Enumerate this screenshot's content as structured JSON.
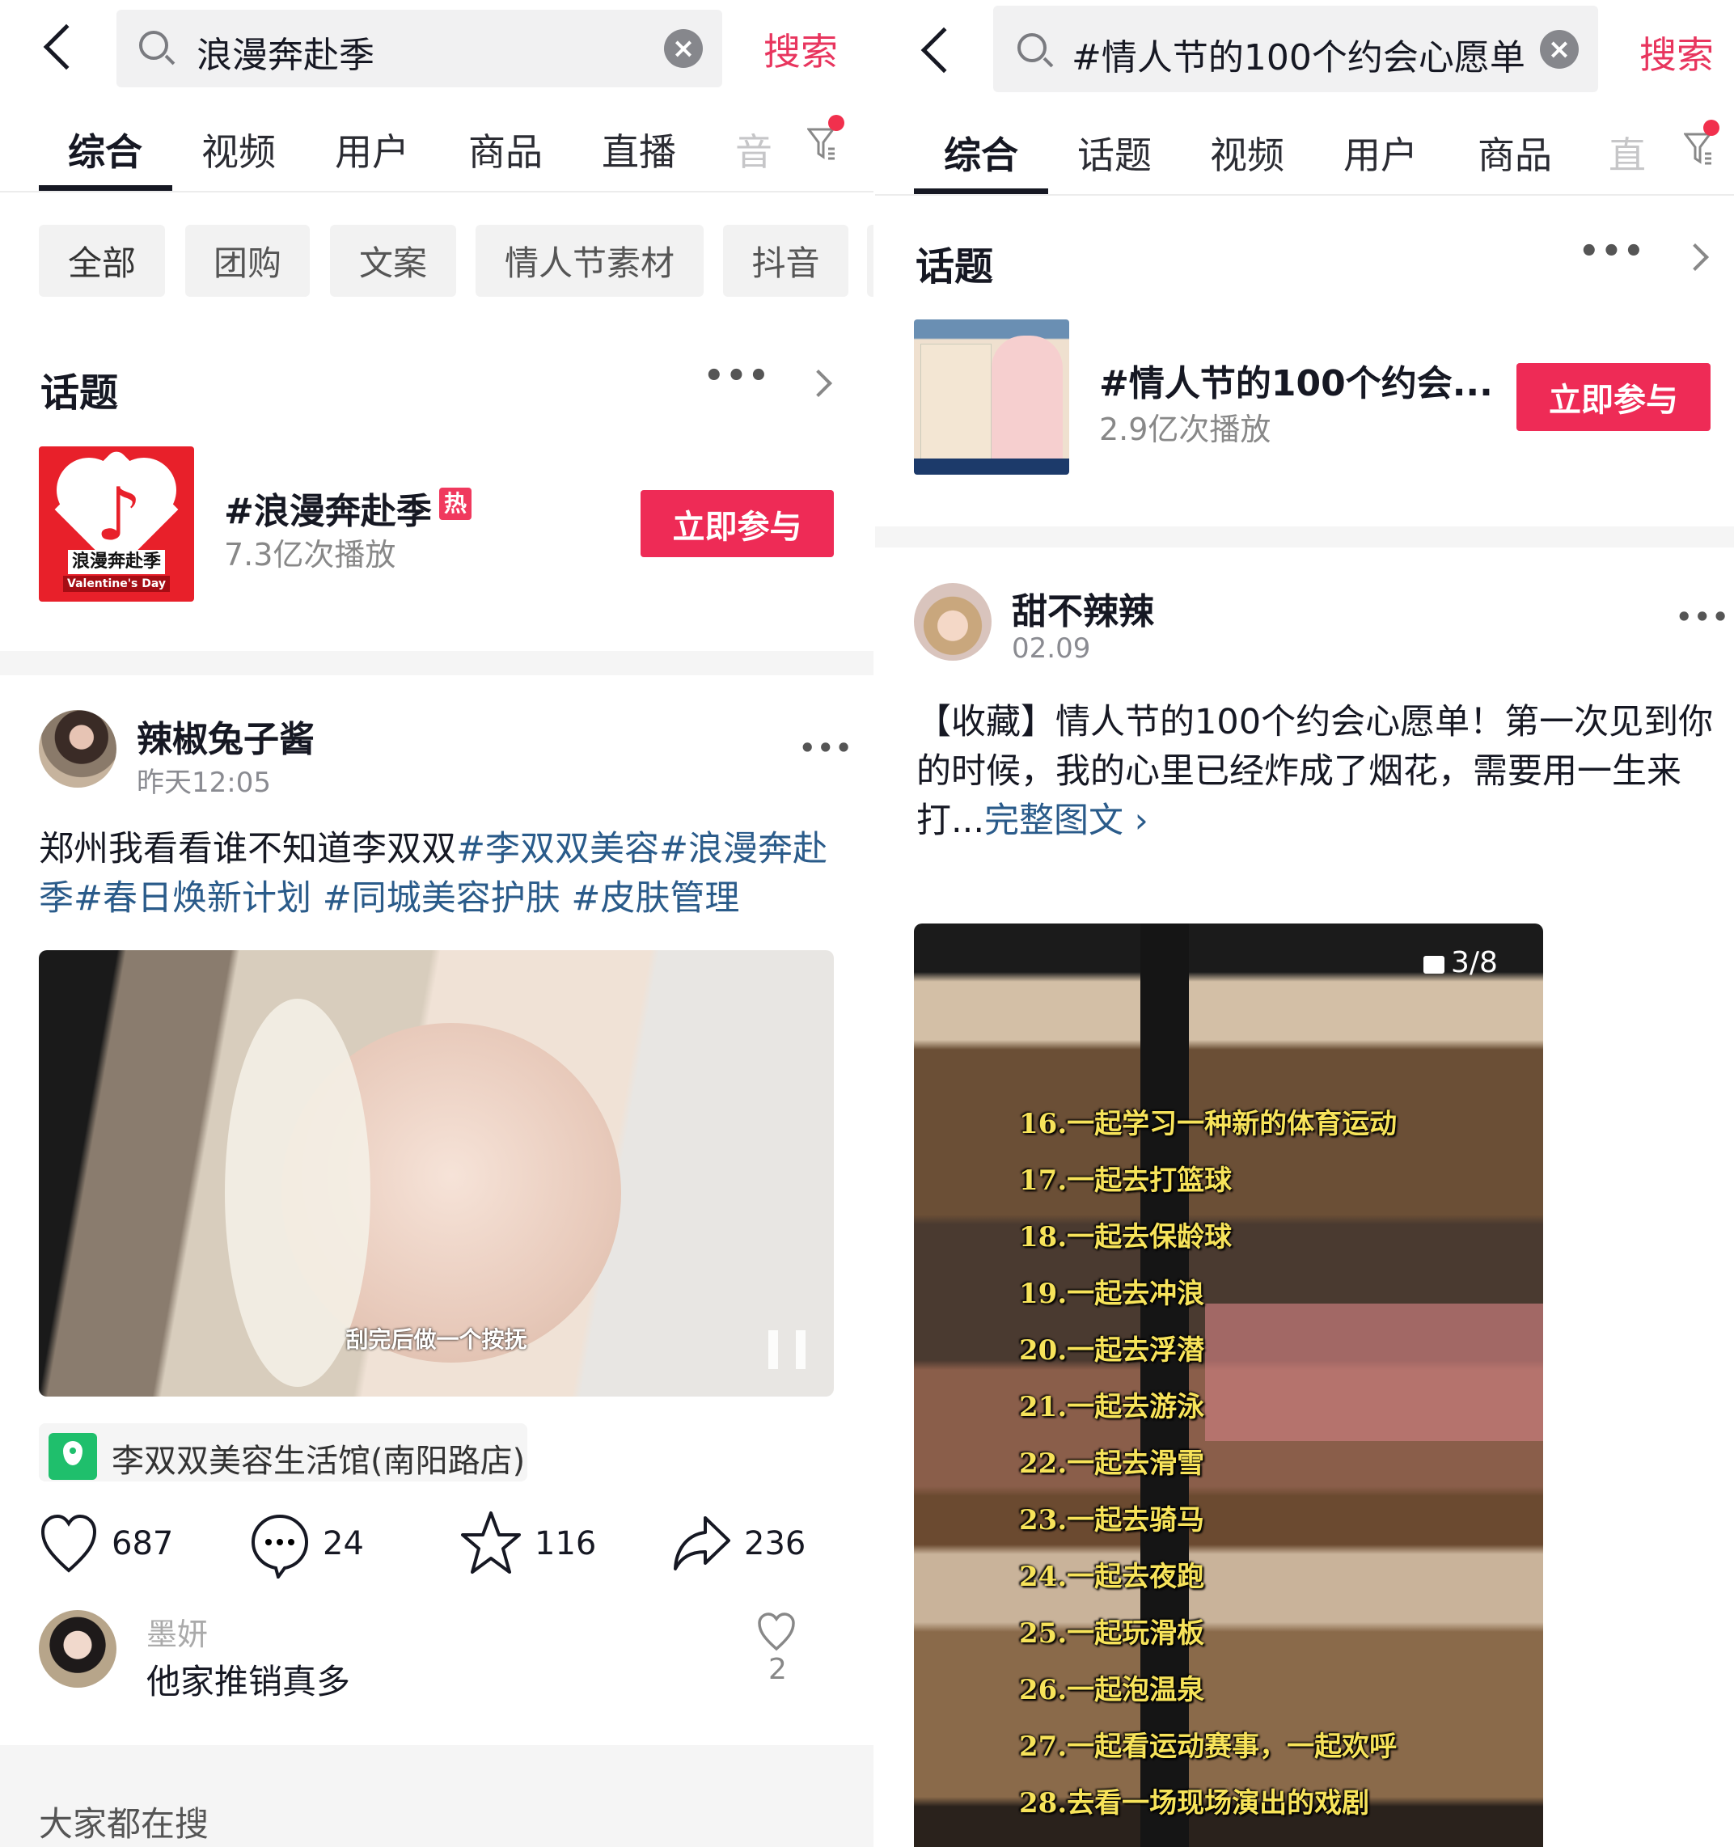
{
  "left": {
    "search": {
      "query": "浪漫奔赴季",
      "submit": "搜索"
    },
    "tabs": [
      {
        "label": "综合",
        "active": true
      },
      {
        "label": "视频"
      },
      {
        "label": "用户"
      },
      {
        "label": "商品"
      },
      {
        "label": "直播"
      },
      {
        "label": "音"
      }
    ],
    "chips": [
      "全部",
      "团购",
      "文案",
      "情人节素材",
      "抖音"
    ],
    "topic_section": {
      "title": "话题"
    },
    "topic": {
      "title": "#浪漫奔赴季",
      "badge": "热",
      "views": "7.3亿次播放",
      "button": "立即参与",
      "thumb_text": "浪漫奔赴季",
      "thumb_sub": "Valentine's Day"
    },
    "post": {
      "author": "辣椒兔子酱",
      "time": "昨天12:05",
      "text_plain": "郑州我看看谁不知道李双双",
      "text_tags": "#李双双美容#浪漫奔赴季#春日焕新计划 #同城美容护肤 #皮肤管理",
      "video_caption": "刮完后做一个按抚",
      "location": "李双双美容生活馆(南阳路店)",
      "stats": {
        "likes": "687",
        "comments": "24",
        "favorites": "116",
        "shares": "236"
      },
      "comment": {
        "user": "墨妍",
        "text": "他家推销真多",
        "likes": "2"
      }
    },
    "footer_title": "大家都在搜"
  },
  "right": {
    "search": {
      "query": "#情人节的100个约会心愿单",
      "submit": "搜索"
    },
    "tabs": [
      {
        "label": "综合",
        "active": true
      },
      {
        "label": "话题"
      },
      {
        "label": "视频"
      },
      {
        "label": "用户"
      },
      {
        "label": "商品"
      },
      {
        "label": "直"
      }
    ],
    "topic_section": {
      "title": "话题"
    },
    "topic": {
      "title": "#情人节的100个约会...",
      "views": "2.9亿次播放",
      "button": "立即参与"
    },
    "post": {
      "author": "甜不辣辣",
      "time": "02.09",
      "text": "【收藏】情人节的100个约会心愿单！第一次见到你的时候，我的心里已经炸成了烟花，需要用一生来打...",
      "more_link": "完整图文",
      "image_counter": "3/8",
      "image_list": [
        "16.一起学习一种新的体育运动",
        "17.一起去打篮球",
        "18.一起去保龄球",
        "19.一起去冲浪",
        "20.一起去浮潜",
        "21.一起去游泳",
        "22.一起去滑雪",
        "23.一起去骑马",
        "24.一起去夜跑",
        "25.一起玩滑板",
        "26.一起泡温泉",
        "27.一起看运动赛事，一起欢呼",
        "28.去看一场现场演出的戏剧"
      ]
    }
  },
  "colors": {
    "accent": "#ee2b56",
    "search_text": "#e8355e",
    "hashtag": "#2a5b8a",
    "location_icon": "#1fbf6c"
  }
}
